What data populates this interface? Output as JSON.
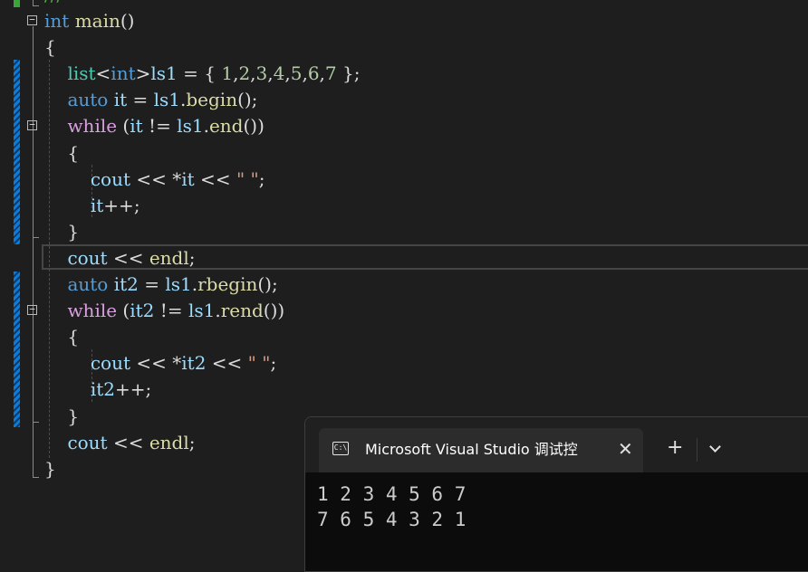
{
  "editor": {
    "top_comment": "///",
    "lines": [
      [
        {
          "t": "int",
          "c": "kw"
        },
        {
          "t": " ",
          "c": "plain"
        },
        {
          "t": "main",
          "c": "fn"
        },
        {
          "t": "()",
          "c": "plain"
        }
      ],
      [
        {
          "t": "{",
          "c": "plain"
        }
      ],
      [
        {
          "t": "    ",
          "c": "plain"
        },
        {
          "t": "list",
          "c": "ty"
        },
        {
          "t": "<",
          "c": "plain"
        },
        {
          "t": "int",
          "c": "kw"
        },
        {
          "t": ">",
          "c": "plain"
        },
        {
          "t": "ls1",
          "c": "var"
        },
        {
          "t": " = { ",
          "c": "plain"
        },
        {
          "t": "1",
          "c": "num"
        },
        {
          "t": ",",
          "c": "plain"
        },
        {
          "t": "2",
          "c": "num"
        },
        {
          "t": ",",
          "c": "plain"
        },
        {
          "t": "3",
          "c": "num"
        },
        {
          "t": ",",
          "c": "plain"
        },
        {
          "t": "4",
          "c": "num"
        },
        {
          "t": ",",
          "c": "plain"
        },
        {
          "t": "5",
          "c": "num"
        },
        {
          "t": ",",
          "c": "plain"
        },
        {
          "t": "6",
          "c": "num"
        },
        {
          "t": ",",
          "c": "plain"
        },
        {
          "t": "7",
          "c": "num"
        },
        {
          "t": " };",
          "c": "plain"
        }
      ],
      [
        {
          "t": "    ",
          "c": "plain"
        },
        {
          "t": "auto",
          "c": "kw"
        },
        {
          "t": " ",
          "c": "plain"
        },
        {
          "t": "it",
          "c": "var"
        },
        {
          "t": " = ",
          "c": "plain"
        },
        {
          "t": "ls1",
          "c": "var"
        },
        {
          "t": ".",
          "c": "plain"
        },
        {
          "t": "begin",
          "c": "fn"
        },
        {
          "t": "();",
          "c": "plain"
        }
      ],
      [
        {
          "t": "    ",
          "c": "plain"
        },
        {
          "t": "while",
          "c": "ctl"
        },
        {
          "t": " (",
          "c": "plain"
        },
        {
          "t": "it",
          "c": "var"
        },
        {
          "t": " != ",
          "c": "plain"
        },
        {
          "t": "ls1",
          "c": "var"
        },
        {
          "t": ".",
          "c": "plain"
        },
        {
          "t": "end",
          "c": "fn"
        },
        {
          "t": "())",
          "c": "plain"
        }
      ],
      [
        {
          "t": "    {",
          "c": "plain"
        }
      ],
      [
        {
          "t": "        ",
          "c": "plain"
        },
        {
          "t": "cout",
          "c": "var"
        },
        {
          "t": " << *",
          "c": "plain"
        },
        {
          "t": "it",
          "c": "var"
        },
        {
          "t": " << ",
          "c": "plain"
        },
        {
          "t": "\" \"",
          "c": "str"
        },
        {
          "t": ";",
          "c": "plain"
        }
      ],
      [
        {
          "t": "        ",
          "c": "plain"
        },
        {
          "t": "it",
          "c": "var"
        },
        {
          "t": "++;",
          "c": "plain"
        }
      ],
      [
        {
          "t": "    }",
          "c": "plain"
        }
      ],
      [
        {
          "t": "    ",
          "c": "plain"
        },
        {
          "t": "cout",
          "c": "var"
        },
        {
          "t": " << ",
          "c": "plain"
        },
        {
          "t": "endl",
          "c": "fn"
        },
        {
          "t": ";",
          "c": "plain"
        }
      ],
      [
        {
          "t": "    ",
          "c": "plain"
        },
        {
          "t": "auto",
          "c": "kw"
        },
        {
          "t": " ",
          "c": "plain"
        },
        {
          "t": "it2",
          "c": "var"
        },
        {
          "t": " = ",
          "c": "plain"
        },
        {
          "t": "ls1",
          "c": "var"
        },
        {
          "t": ".",
          "c": "plain"
        },
        {
          "t": "rbegin",
          "c": "fn"
        },
        {
          "t": "();",
          "c": "plain"
        }
      ],
      [
        {
          "t": "    ",
          "c": "plain"
        },
        {
          "t": "while",
          "c": "ctl"
        },
        {
          "t": " (",
          "c": "plain"
        },
        {
          "t": "it2",
          "c": "var"
        },
        {
          "t": " != ",
          "c": "plain"
        },
        {
          "t": "ls1",
          "c": "var"
        },
        {
          "t": ".",
          "c": "plain"
        },
        {
          "t": "rend",
          "c": "fn"
        },
        {
          "t": "())",
          "c": "plain"
        }
      ],
      [
        {
          "t": "    {",
          "c": "plain"
        }
      ],
      [
        {
          "t": "        ",
          "c": "plain"
        },
        {
          "t": "cout",
          "c": "var"
        },
        {
          "t": " << *",
          "c": "plain"
        },
        {
          "t": "it2",
          "c": "var"
        },
        {
          "t": " << ",
          "c": "plain"
        },
        {
          "t": "\" \"",
          "c": "str"
        },
        {
          "t": ";",
          "c": "plain"
        }
      ],
      [
        {
          "t": "        ",
          "c": "plain"
        },
        {
          "t": "it2",
          "c": "var"
        },
        {
          "t": "++;",
          "c": "plain"
        }
      ],
      [
        {
          "t": "    }",
          "c": "plain"
        }
      ],
      [
        {
          "t": "    ",
          "c": "plain"
        },
        {
          "t": "cout",
          "c": "var"
        },
        {
          "t": " << ",
          "c": "plain"
        },
        {
          "t": "endl",
          "c": "fn"
        },
        {
          "t": ";",
          "c": "plain"
        }
      ],
      [
        {
          "t": "}",
          "c": "plain"
        }
      ]
    ],
    "fold_symbol": "−"
  },
  "console": {
    "icon_label": "C:\\",
    "tab_title": "Microsoft Visual Studio 调试控",
    "close_glyph": "✕",
    "new_tab_glyph": "+",
    "output": [
      "1 2 3 4 5 6 7",
      "7 6 5 4 3 2 1"
    ]
  }
}
